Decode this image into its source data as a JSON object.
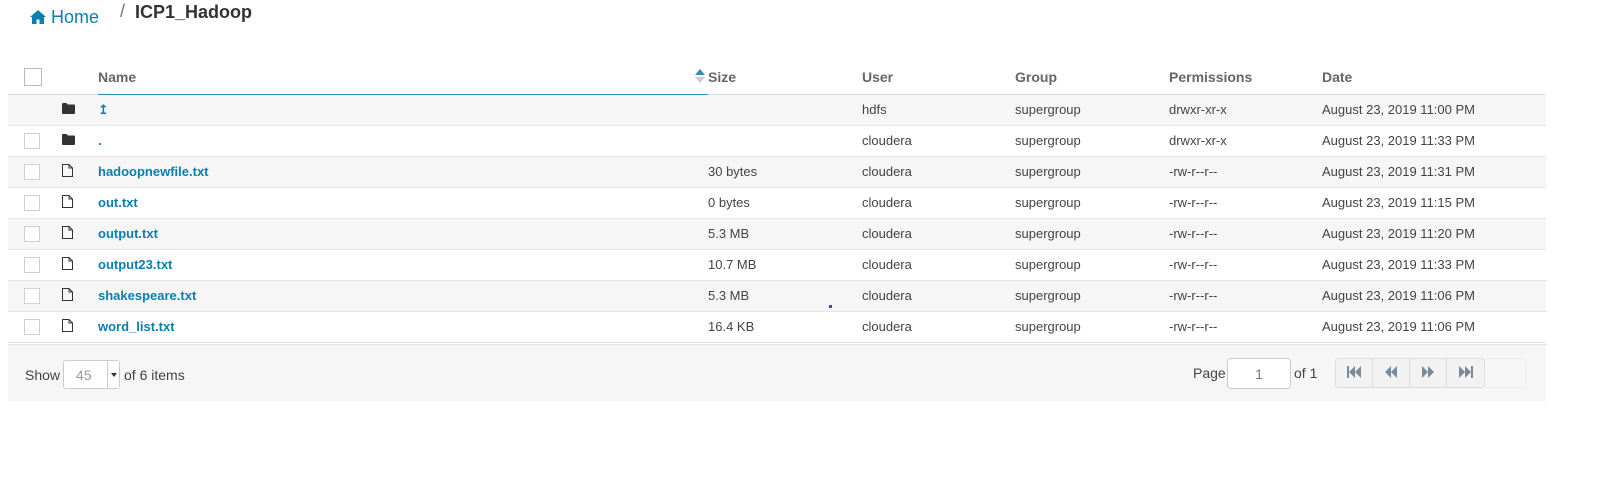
{
  "breadcrumb": {
    "home_icon": "home-icon",
    "home_label": "Home",
    "separator": "/",
    "current": "ICP1_Hadoop"
  },
  "table": {
    "columns": {
      "name": "Name",
      "size": "Size",
      "user": "User",
      "group": "Group",
      "permissions": "Permissions",
      "date": "Date"
    },
    "sort": {
      "column": "name",
      "direction": "ascending"
    },
    "rows": [
      {
        "icon": "folder-icon",
        "name": "↥",
        "size": "",
        "user": "hdfs",
        "group": "supergroup",
        "permissions": "drwxr-xr-x",
        "date": "August 23, 2019 11:00 PM",
        "has_checkbox": false
      },
      {
        "icon": "folder-icon",
        "name": ".",
        "size": "",
        "user": "cloudera",
        "group": "supergroup",
        "permissions": "drwxr-xr-x",
        "date": "August 23, 2019 11:33 PM",
        "has_checkbox": true
      },
      {
        "icon": "file-icon",
        "name": "hadoopnewfile.txt",
        "size": "30 bytes",
        "user": "cloudera",
        "group": "supergroup",
        "permissions": "-rw-r--r--",
        "date": "August 23, 2019 11:31 PM",
        "has_checkbox": true
      },
      {
        "icon": "file-icon",
        "name": "out.txt",
        "size": "0 bytes",
        "user": "cloudera",
        "group": "supergroup",
        "permissions": "-rw-r--r--",
        "date": "August 23, 2019 11:15 PM",
        "has_checkbox": true
      },
      {
        "icon": "file-icon",
        "name": "output.txt",
        "size": "5.3 MB",
        "user": "cloudera",
        "group": "supergroup",
        "permissions": "-rw-r--r--",
        "date": "August 23, 2019 11:20 PM",
        "has_checkbox": true
      },
      {
        "icon": "file-icon",
        "name": "output23.txt",
        "size": "10.7 MB",
        "user": "cloudera",
        "group": "supergroup",
        "permissions": "-rw-r--r--",
        "date": "August 23, 2019 11:33 PM",
        "has_checkbox": true
      },
      {
        "icon": "file-icon",
        "name": "shakespeare.txt",
        "size": "5.3 MB",
        "user": "cloudera",
        "group": "supergroup",
        "permissions": "-rw-r--r--",
        "date": "August 23, 2019 11:06 PM",
        "has_checkbox": true
      },
      {
        "icon": "file-icon",
        "name": "word_list.txt",
        "size": "16.4 KB",
        "user": "cloudera",
        "group": "supergroup",
        "permissions": "-rw-r--r--",
        "date": "August 23, 2019 11:06 PM",
        "has_checkbox": true
      }
    ]
  },
  "footer": {
    "show_label": "Show",
    "page_size": "45",
    "items_label": "of 6 items",
    "page_label": "Page",
    "page_value": "1",
    "page_of": "of 1",
    "pager_icons": [
      "first-page-icon",
      "previous-page-icon",
      "next-page-icon",
      "last-page-icon"
    ]
  },
  "colors": {
    "link": "#0b7fad",
    "header_text": "#666666",
    "row_alt": "#f6f6f6",
    "sort_accent": "#338bb8"
  }
}
